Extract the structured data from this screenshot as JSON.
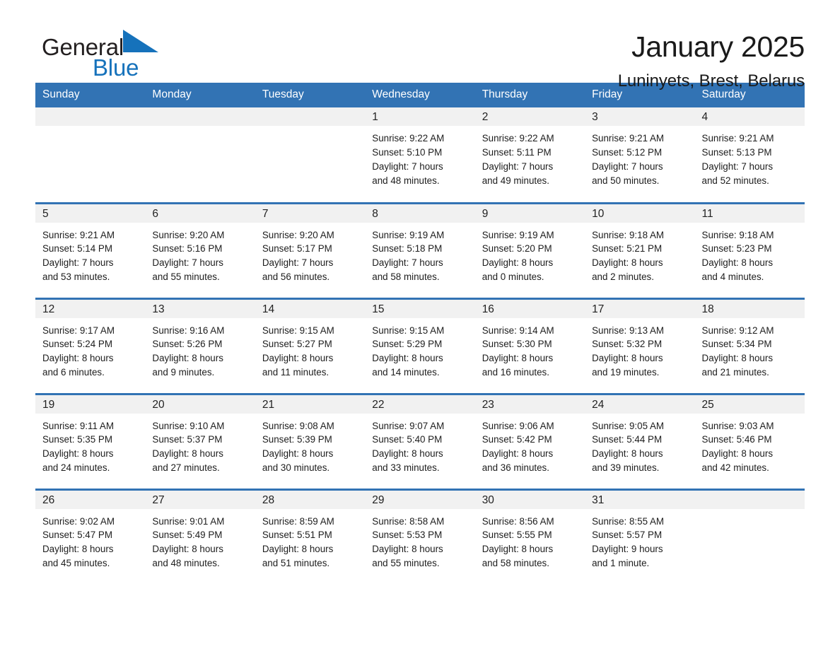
{
  "brand": {
    "name_part1": "General",
    "name_part2": "Blue",
    "flag_icon": "triangle-flag-icon",
    "accent_color": "#1672bb"
  },
  "header": {
    "month_title": "January 2025",
    "location": "Luninyets, Brest, Belarus"
  },
  "theme": {
    "header_bar_color": "#3273b4",
    "daynum_band_color": "#f1f1f1",
    "row_divider_color": "#3273b4",
    "text_color": "#1d1d1d"
  },
  "calendar": {
    "day_headers": [
      "Sunday",
      "Monday",
      "Tuesday",
      "Wednesday",
      "Thursday",
      "Friday",
      "Saturday"
    ],
    "weeks": [
      [
        {
          "day": "",
          "empty": true
        },
        {
          "day": "",
          "empty": true
        },
        {
          "day": "",
          "empty": true
        },
        {
          "day": "1",
          "sunrise": "Sunrise: 9:22 AM",
          "sunset": "Sunset: 5:10 PM",
          "daylight_line1": "Daylight: 7 hours",
          "daylight_line2": "and 48 minutes."
        },
        {
          "day": "2",
          "sunrise": "Sunrise: 9:22 AM",
          "sunset": "Sunset: 5:11 PM",
          "daylight_line1": "Daylight: 7 hours",
          "daylight_line2": "and 49 minutes."
        },
        {
          "day": "3",
          "sunrise": "Sunrise: 9:21 AM",
          "sunset": "Sunset: 5:12 PM",
          "daylight_line1": "Daylight: 7 hours",
          "daylight_line2": "and 50 minutes."
        },
        {
          "day": "4",
          "sunrise": "Sunrise: 9:21 AM",
          "sunset": "Sunset: 5:13 PM",
          "daylight_line1": "Daylight: 7 hours",
          "daylight_line2": "and 52 minutes."
        }
      ],
      [
        {
          "day": "5",
          "sunrise": "Sunrise: 9:21 AM",
          "sunset": "Sunset: 5:14 PM",
          "daylight_line1": "Daylight: 7 hours",
          "daylight_line2": "and 53 minutes."
        },
        {
          "day": "6",
          "sunrise": "Sunrise: 9:20 AM",
          "sunset": "Sunset: 5:16 PM",
          "daylight_line1": "Daylight: 7 hours",
          "daylight_line2": "and 55 minutes."
        },
        {
          "day": "7",
          "sunrise": "Sunrise: 9:20 AM",
          "sunset": "Sunset: 5:17 PM",
          "daylight_line1": "Daylight: 7 hours",
          "daylight_line2": "and 56 minutes."
        },
        {
          "day": "8",
          "sunrise": "Sunrise: 9:19 AM",
          "sunset": "Sunset: 5:18 PM",
          "daylight_line1": "Daylight: 7 hours",
          "daylight_line2": "and 58 minutes."
        },
        {
          "day": "9",
          "sunrise": "Sunrise: 9:19 AM",
          "sunset": "Sunset: 5:20 PM",
          "daylight_line1": "Daylight: 8 hours",
          "daylight_line2": "and 0 minutes."
        },
        {
          "day": "10",
          "sunrise": "Sunrise: 9:18 AM",
          "sunset": "Sunset: 5:21 PM",
          "daylight_line1": "Daylight: 8 hours",
          "daylight_line2": "and 2 minutes."
        },
        {
          "day": "11",
          "sunrise": "Sunrise: 9:18 AM",
          "sunset": "Sunset: 5:23 PM",
          "daylight_line1": "Daylight: 8 hours",
          "daylight_line2": "and 4 minutes."
        }
      ],
      [
        {
          "day": "12",
          "sunrise": "Sunrise: 9:17 AM",
          "sunset": "Sunset: 5:24 PM",
          "daylight_line1": "Daylight: 8 hours",
          "daylight_line2": "and 6 minutes."
        },
        {
          "day": "13",
          "sunrise": "Sunrise: 9:16 AM",
          "sunset": "Sunset: 5:26 PM",
          "daylight_line1": "Daylight: 8 hours",
          "daylight_line2": "and 9 minutes."
        },
        {
          "day": "14",
          "sunrise": "Sunrise: 9:15 AM",
          "sunset": "Sunset: 5:27 PM",
          "daylight_line1": "Daylight: 8 hours",
          "daylight_line2": "and 11 minutes."
        },
        {
          "day": "15",
          "sunrise": "Sunrise: 9:15 AM",
          "sunset": "Sunset: 5:29 PM",
          "daylight_line1": "Daylight: 8 hours",
          "daylight_line2": "and 14 minutes."
        },
        {
          "day": "16",
          "sunrise": "Sunrise: 9:14 AM",
          "sunset": "Sunset: 5:30 PM",
          "daylight_line1": "Daylight: 8 hours",
          "daylight_line2": "and 16 minutes."
        },
        {
          "day": "17",
          "sunrise": "Sunrise: 9:13 AM",
          "sunset": "Sunset: 5:32 PM",
          "daylight_line1": "Daylight: 8 hours",
          "daylight_line2": "and 19 minutes."
        },
        {
          "day": "18",
          "sunrise": "Sunrise: 9:12 AM",
          "sunset": "Sunset: 5:34 PM",
          "daylight_line1": "Daylight: 8 hours",
          "daylight_line2": "and 21 minutes."
        }
      ],
      [
        {
          "day": "19",
          "sunrise": "Sunrise: 9:11 AM",
          "sunset": "Sunset: 5:35 PM",
          "daylight_line1": "Daylight: 8 hours",
          "daylight_line2": "and 24 minutes."
        },
        {
          "day": "20",
          "sunrise": "Sunrise: 9:10 AM",
          "sunset": "Sunset: 5:37 PM",
          "daylight_line1": "Daylight: 8 hours",
          "daylight_line2": "and 27 minutes."
        },
        {
          "day": "21",
          "sunrise": "Sunrise: 9:08 AM",
          "sunset": "Sunset: 5:39 PM",
          "daylight_line1": "Daylight: 8 hours",
          "daylight_line2": "and 30 minutes."
        },
        {
          "day": "22",
          "sunrise": "Sunrise: 9:07 AM",
          "sunset": "Sunset: 5:40 PM",
          "daylight_line1": "Daylight: 8 hours",
          "daylight_line2": "and 33 minutes."
        },
        {
          "day": "23",
          "sunrise": "Sunrise: 9:06 AM",
          "sunset": "Sunset: 5:42 PM",
          "daylight_line1": "Daylight: 8 hours",
          "daylight_line2": "and 36 minutes."
        },
        {
          "day": "24",
          "sunrise": "Sunrise: 9:05 AM",
          "sunset": "Sunset: 5:44 PM",
          "daylight_line1": "Daylight: 8 hours",
          "daylight_line2": "and 39 minutes."
        },
        {
          "day": "25",
          "sunrise": "Sunrise: 9:03 AM",
          "sunset": "Sunset: 5:46 PM",
          "daylight_line1": "Daylight: 8 hours",
          "daylight_line2": "and 42 minutes."
        }
      ],
      [
        {
          "day": "26",
          "sunrise": "Sunrise: 9:02 AM",
          "sunset": "Sunset: 5:47 PM",
          "daylight_line1": "Daylight: 8 hours",
          "daylight_line2": "and 45 minutes."
        },
        {
          "day": "27",
          "sunrise": "Sunrise: 9:01 AM",
          "sunset": "Sunset: 5:49 PM",
          "daylight_line1": "Daylight: 8 hours",
          "daylight_line2": "and 48 minutes."
        },
        {
          "day": "28",
          "sunrise": "Sunrise: 8:59 AM",
          "sunset": "Sunset: 5:51 PM",
          "daylight_line1": "Daylight: 8 hours",
          "daylight_line2": "and 51 minutes."
        },
        {
          "day": "29",
          "sunrise": "Sunrise: 8:58 AM",
          "sunset": "Sunset: 5:53 PM",
          "daylight_line1": "Daylight: 8 hours",
          "daylight_line2": "and 55 minutes."
        },
        {
          "day": "30",
          "sunrise": "Sunrise: 8:56 AM",
          "sunset": "Sunset: 5:55 PM",
          "daylight_line1": "Daylight: 8 hours",
          "daylight_line2": "and 58 minutes."
        },
        {
          "day": "31",
          "sunrise": "Sunrise: 8:55 AM",
          "sunset": "Sunset: 5:57 PM",
          "daylight_line1": "Daylight: 9 hours",
          "daylight_line2": "and 1 minute."
        },
        {
          "day": "",
          "empty": true
        }
      ]
    ]
  }
}
